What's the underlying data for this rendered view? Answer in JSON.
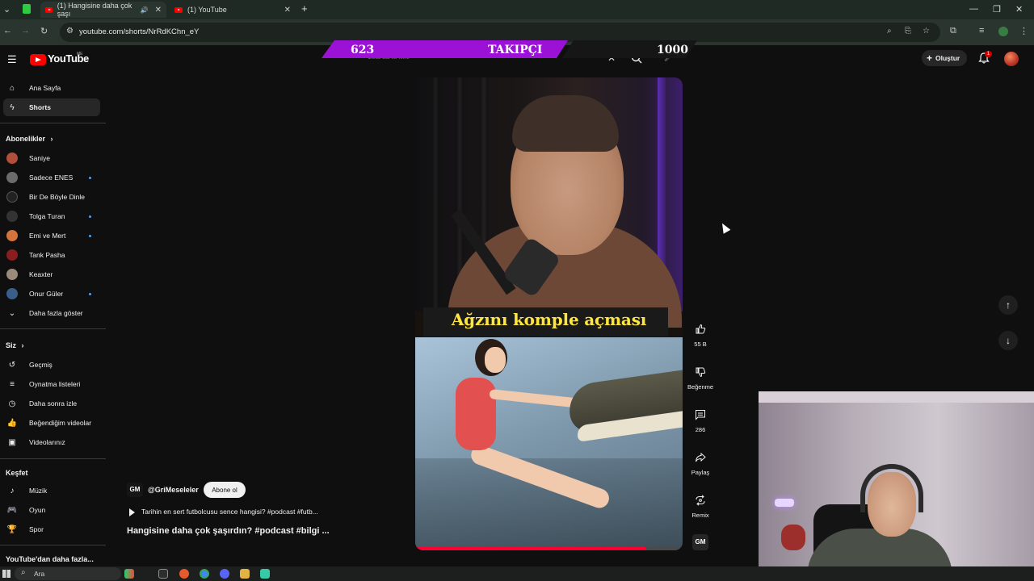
{
  "browser": {
    "tabs": [
      {
        "label": "(1) Hangisine daha çok şaşı",
        "active": true
      },
      {
        "label": "(1) YouTube",
        "active": false
      }
    ],
    "url": "youtube.com/shorts/NrRdKChn_eY"
  },
  "masthead": {
    "logo_text": "YouTube",
    "logo_country": "ME",
    "search_placeholder": "Gelal Lal ile fikro",
    "create_label": "Oluştur",
    "notification_count": "1"
  },
  "overlay": {
    "current_followers": "623",
    "label": "TAKIPÇI",
    "goal": "1000"
  },
  "sidebar": {
    "main": [
      {
        "label": "Ana Sayfa",
        "icon": "home-icon"
      },
      {
        "label": "Shorts",
        "icon": "shorts-icon",
        "active": true
      }
    ],
    "subscriptions_title": "Abonelikler",
    "subscriptions": [
      {
        "label": "Saniye",
        "color": "#b24f3a",
        "dot": false
      },
      {
        "label": "Sadece ENES",
        "color": "#6b6b6b",
        "dot": true
      },
      {
        "label": "Bir De Böyle Dinle",
        "color": "#222222",
        "dot": false
      },
      {
        "label": "Tolga Turan",
        "color": "#333333",
        "dot": true
      },
      {
        "label": "Emi ve Mert",
        "color": "#d4733a",
        "dot": true
      },
      {
        "label": "Tank Pasha",
        "color": "#8a1e1e",
        "dot": false
      },
      {
        "label": "Keaxter",
        "color": "#9a8a7a",
        "dot": false
      },
      {
        "label": "Onur Güler",
        "color": "#3a5e8c",
        "dot": true
      }
    ],
    "show_more": "Daha fazla göster",
    "you_title": "Siz",
    "you_items": [
      {
        "label": "Geçmiş",
        "icon": "history-icon"
      },
      {
        "label": "Oynatma listeleri",
        "icon": "playlists-icon"
      },
      {
        "label": "Daha sonra izle",
        "icon": "watch-later-icon"
      },
      {
        "label": "Beğendiğim videolar",
        "icon": "liked-videos-icon"
      },
      {
        "label": "Videolarınız",
        "icon": "your-videos-icon"
      }
    ],
    "explore_title": "Keşfet",
    "explore_items": [
      {
        "label": "Müzik",
        "icon": "music-icon"
      },
      {
        "label": "Oyun",
        "icon": "gaming-icon"
      },
      {
        "label": "Spor",
        "icon": "sports-icon"
      }
    ],
    "more_title": "YouTube'dan daha fazla..."
  },
  "video": {
    "caption": "Ağzını komple açması",
    "channel_handle": "@GriMeseleler",
    "channel_badge": "GM",
    "subscribe_label": "Abone ol",
    "suggestion": "Tarihin en sert futbolcusu sence hangisi? #podcast #futb...",
    "title": "Hangisine daha çok şaşırdın? #podcast #bilgi ...",
    "progress": 0.86
  },
  "actions": {
    "like_count": "55 B",
    "dislike_label": "Beğenme",
    "comment_count": "286",
    "share_label": "Paylaş",
    "remix_label": "Remix"
  },
  "taskbar": {
    "search_label": "Ara"
  }
}
